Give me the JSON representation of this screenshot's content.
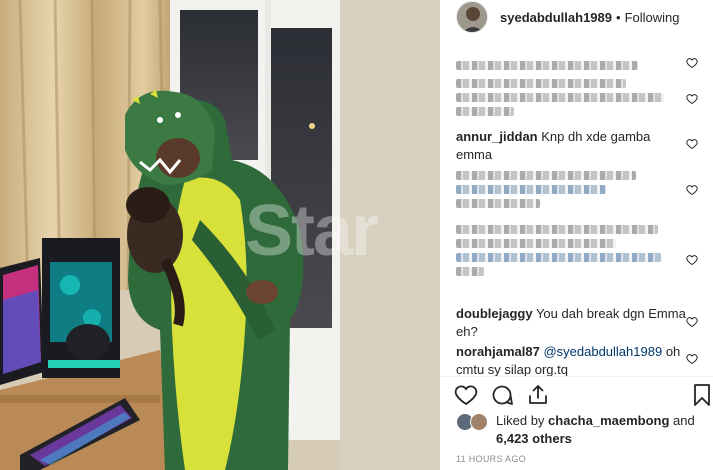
{
  "post": {
    "username": "syedabdullah1989",
    "separator": "•",
    "follow_status": "Following",
    "watermark": "Star"
  },
  "comments": [
    {
      "type": "blurred",
      "lines": 1
    },
    {
      "type": "blurred",
      "lines": 3
    },
    {
      "type": "text",
      "author": "annur_jiddan",
      "text": "Knp dh xde gamba emma"
    },
    {
      "type": "blurred",
      "lines": 3
    },
    {
      "type": "blurred",
      "lines": 4
    },
    {
      "type": "text",
      "author": "doublejaggy",
      "text": "You dah break dgn Emma eh?"
    },
    {
      "type": "text",
      "author": "norahjamal87",
      "mention": "@syedabdullah1989",
      "text": "oh cmtu sy silap org.tq"
    }
  ],
  "likes": {
    "prefix": "Liked by",
    "user": "chacha_maembong",
    "middle": "and",
    "count": "6,423 others"
  },
  "timestamp": "11 HOURS AGO",
  "icons": [
    "heart-icon",
    "comment-icon",
    "share-icon",
    "bookmark-icon"
  ],
  "colors": {
    "text": "#262626",
    "muted": "#8e8e8e",
    "link": "#00376b",
    "costume_green": "#2f6b3a",
    "costume_yellow": "#d8e03a"
  }
}
